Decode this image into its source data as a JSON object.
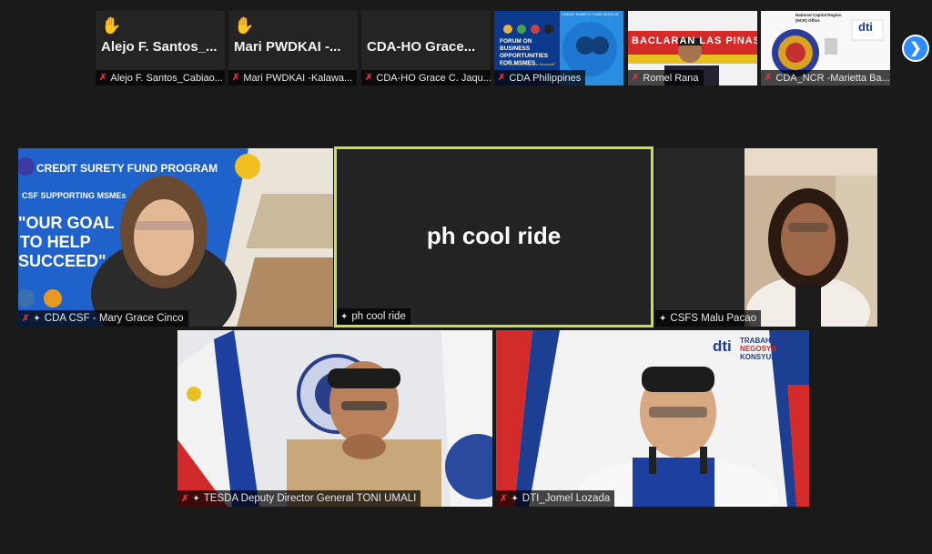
{
  "strip": [
    {
      "big_name": "Alejo F. Santos_...",
      "label": "Alejo F. Santos_Cabiao...",
      "hand": "✋"
    },
    {
      "big_name": "Mari PWDKAI -...",
      "label": "Mari PWDKAI -Kalawa...",
      "hand": "✋"
    },
    {
      "big_name": "CDA-HO Grace...",
      "label": "CDA-HO Grace C. Jaqu..."
    },
    {
      "label": "CDA Philippines",
      "slide_header": "CREDIT SURETY FUND SERVICE",
      "slide_title": "FORUM ON BUSINESS OPPORTUNITIES FOR MSMES",
      "slide_sub": "\"Our Goal is to help you Succeed!\""
    },
    {
      "label": "Romel Rana",
      "banner_text": "BACLARAN LAS PINAS"
    },
    {
      "label": "CDA_NCR -Marietta Ba...",
      "header_text": "National Capital Region (NCR) Office",
      "logo_text": "dti"
    }
  ],
  "gallery": [
    {
      "label": "CDA CSF - Mary Grace Cinco",
      "bg_title": "CREDIT SURETY FUND PROGRAM",
      "bg_sub": "CSF SUPPORTING MSMEs",
      "bg_quote": [
        "\"OUR GOAL",
        "TO HELP",
        "SUCCEED\""
      ]
    },
    {
      "label": "ph cool ride",
      "center_name": "ph cool ride"
    },
    {
      "label": "CSFS Malu Pacao"
    },
    {
      "label": "TESDA Deputy Director General TONI UMALI"
    },
    {
      "label": "DTI_Jomel Lozada",
      "logo_dti": "dti",
      "logo_tagline": [
        "TRABAHO",
        "NEGOSYO",
        "KONSYUMER"
      ]
    }
  ],
  "icons": {
    "mic_muted": "✗",
    "pin": "✦",
    "next": "❯"
  },
  "colors": {
    "active_border": "#c9e04a",
    "muted_mic": "#e0353b",
    "nav_blue": "#2d8cff"
  }
}
